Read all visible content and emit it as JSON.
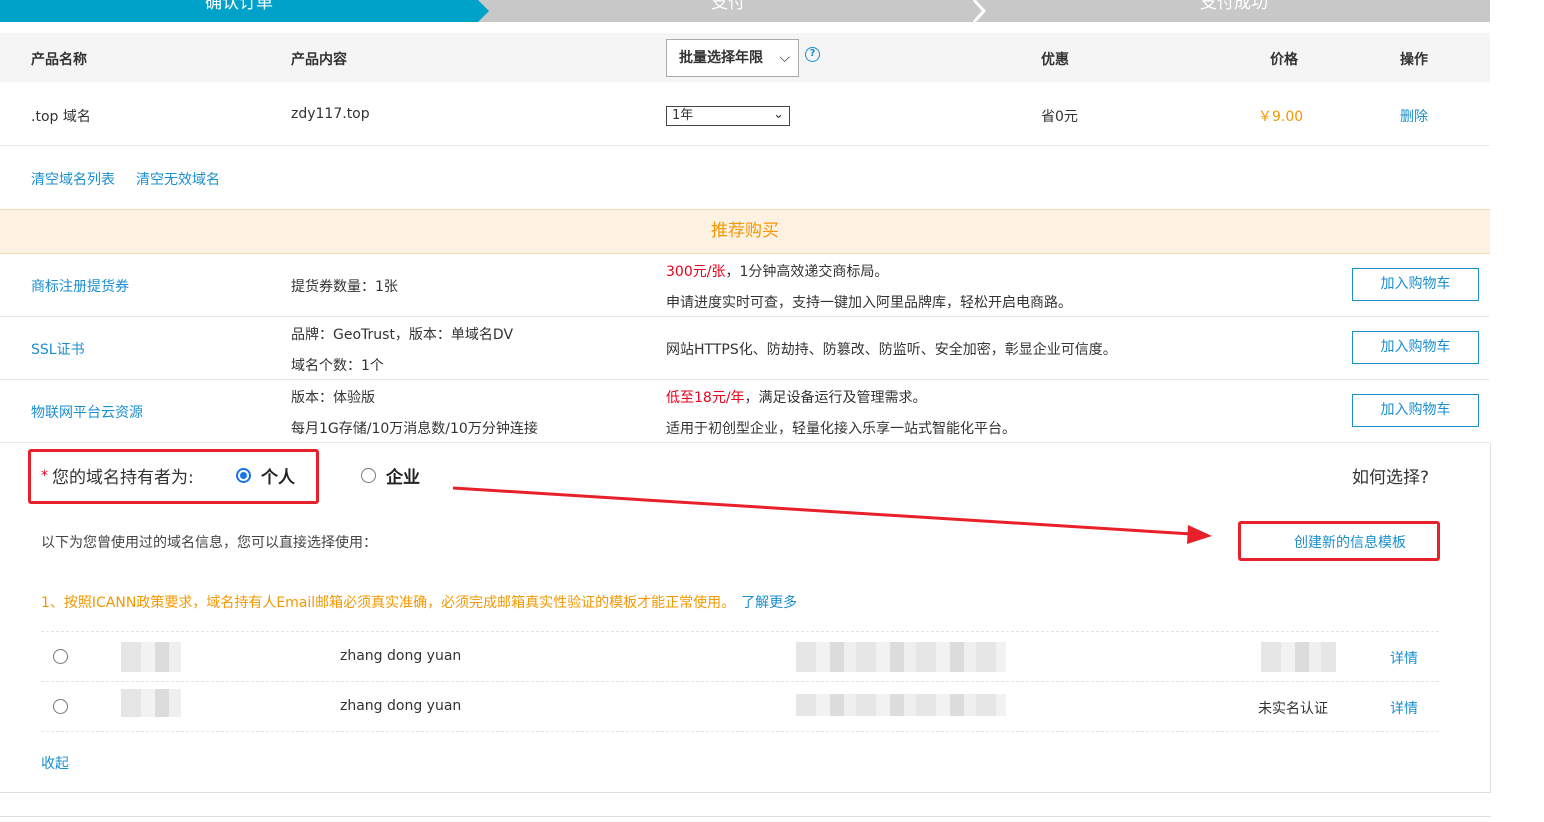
{
  "steps": [
    "确认订单",
    "支付",
    "支付成功"
  ],
  "header": {
    "product_name": "产品名称",
    "product_content": "产品内容",
    "batch_select": "批量选择年限",
    "discount": "优惠",
    "price": "价格",
    "operation": "操作"
  },
  "item": {
    "name": ".top 域名",
    "content": "zdy117.top",
    "years": "1年",
    "discount": "省0元",
    "price": "￥9.00",
    "delete": "删除"
  },
  "clear": {
    "list": "清空域名列表",
    "invalid": "清空无效域名"
  },
  "recommend": {
    "title": "推荐购买",
    "cart_label": "加入购物车",
    "items": [
      {
        "name": "商标注册提货券",
        "detail1": "提货券数量：1张",
        "detail2": "",
        "desc_red": "300元/张",
        "desc1": "，1分钟高效递交商标局。",
        "desc2": "申请进度实时可查，支持一键加入阿里品牌库，轻松开启电商路。"
      },
      {
        "name": "SSL证书",
        "detail1": "品牌：GeoTrust，版本：单域名DV",
        "detail2": "域名个数：1个",
        "desc_red": "",
        "desc1": "网站HTTPS化、防劫持、防篡改、防监听、安全加密，彰显企业可信度。",
        "desc2": ""
      },
      {
        "name": "物联网平台云资源",
        "detail1": "版本：体验版",
        "detail2": "每月1G存储/10万消息数/10万分钟连接",
        "desc_red": "低至18元/年",
        "desc1": "，满足设备运行及管理需求。",
        "desc2": "适用于初创型企业，轻量化接入乐享一站式智能化平台。"
      }
    ]
  },
  "holder": {
    "label": "您的域名持有者为:",
    "star": "*",
    "option_personal": "个人",
    "option_company": "企业",
    "selected": "个人",
    "how_to_choose": "如何选择?",
    "info_text": "以下为您曾使用过的域名信息，您可以直接选择使用：",
    "create_template": "创建新的信息模板",
    "notice": "1、按照ICANN政策要求，域名持有人Email邮箱必须真实准确，必须完成邮箱真实性验证的模板才能正常使用。",
    "learn_more": "了解更多",
    "templates": [
      {
        "name": "zhang dong yuan",
        "status": "",
        "detail": "详情"
      },
      {
        "name": "zhang dong yuan",
        "status": "未实名认证",
        "detail": "详情"
      }
    ],
    "collapse": "收起"
  },
  "colors": {
    "primary": "#00a2ca",
    "link": "#1a8fd0",
    "orange": "#f39800",
    "red": "#e8202a"
  }
}
